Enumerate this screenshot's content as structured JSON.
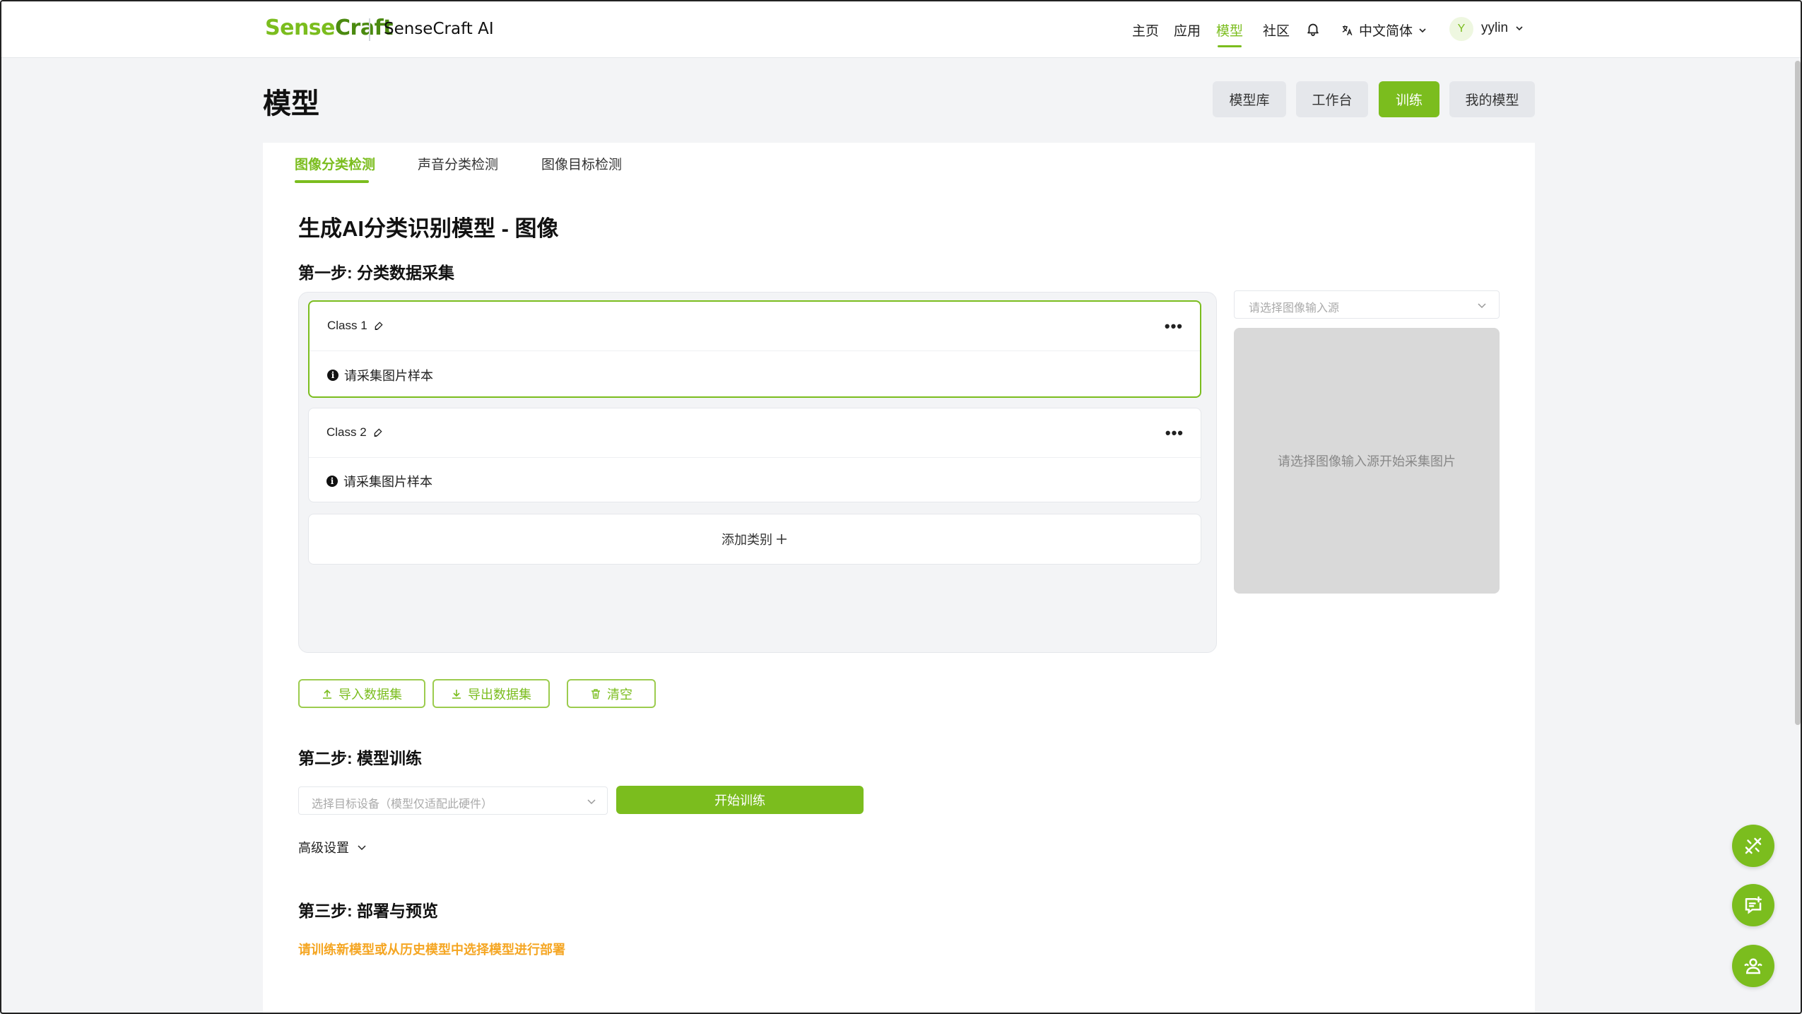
{
  "header": {
    "logo_sense": "Sense",
    "logo_craft": "Craft",
    "app_name": "SenseCraft AI",
    "nav": [
      "主页",
      "应用",
      "模型",
      "社区"
    ],
    "active_nav": "模型",
    "language": "中文简体",
    "avatar_letter": "Y",
    "username": "yylin"
  },
  "page": {
    "title": "模型",
    "top_tabs": [
      "模型库",
      "工作台",
      "训练",
      "我的模型"
    ],
    "active_top_tab": "训练"
  },
  "sub_tabs": [
    "图像分类检测",
    "声音分类检测",
    "图像目标检测"
  ],
  "active_sub_tab": "图像分类检测",
  "main": {
    "heading": "生成AI分类识别模型 - 图像",
    "step1": {
      "title": "第一步: 分类数据采集",
      "classes": [
        {
          "name": "Class 1",
          "hint": "请采集图片样本",
          "selected": true
        },
        {
          "name": "Class 2",
          "hint": "请采集图片样本",
          "selected": false
        }
      ],
      "add_class_label": "添加类别",
      "source_placeholder": "请选择图像输入源",
      "preview_hint": "请选择图像输入源开始采集图片",
      "buttons": {
        "import": "导入数据集",
        "export": "导出数据集",
        "clear": "清空"
      }
    },
    "step2": {
      "title": "第二步: 模型训练",
      "device_placeholder": "选择目标设备（模型仅适配此硬件）",
      "train_label": "开始训练",
      "advanced_label": "高级设置"
    },
    "step3": {
      "title": "第三步: 部署与预览",
      "hint": "请训练新模型或从历史模型中选择模型进行部署"
    }
  },
  "colors": {
    "accent": "#7bbd1e",
    "warning": "#f5a623"
  },
  "fab_icons": [
    "tools-icon",
    "feedback-icon",
    "community-icon"
  ]
}
